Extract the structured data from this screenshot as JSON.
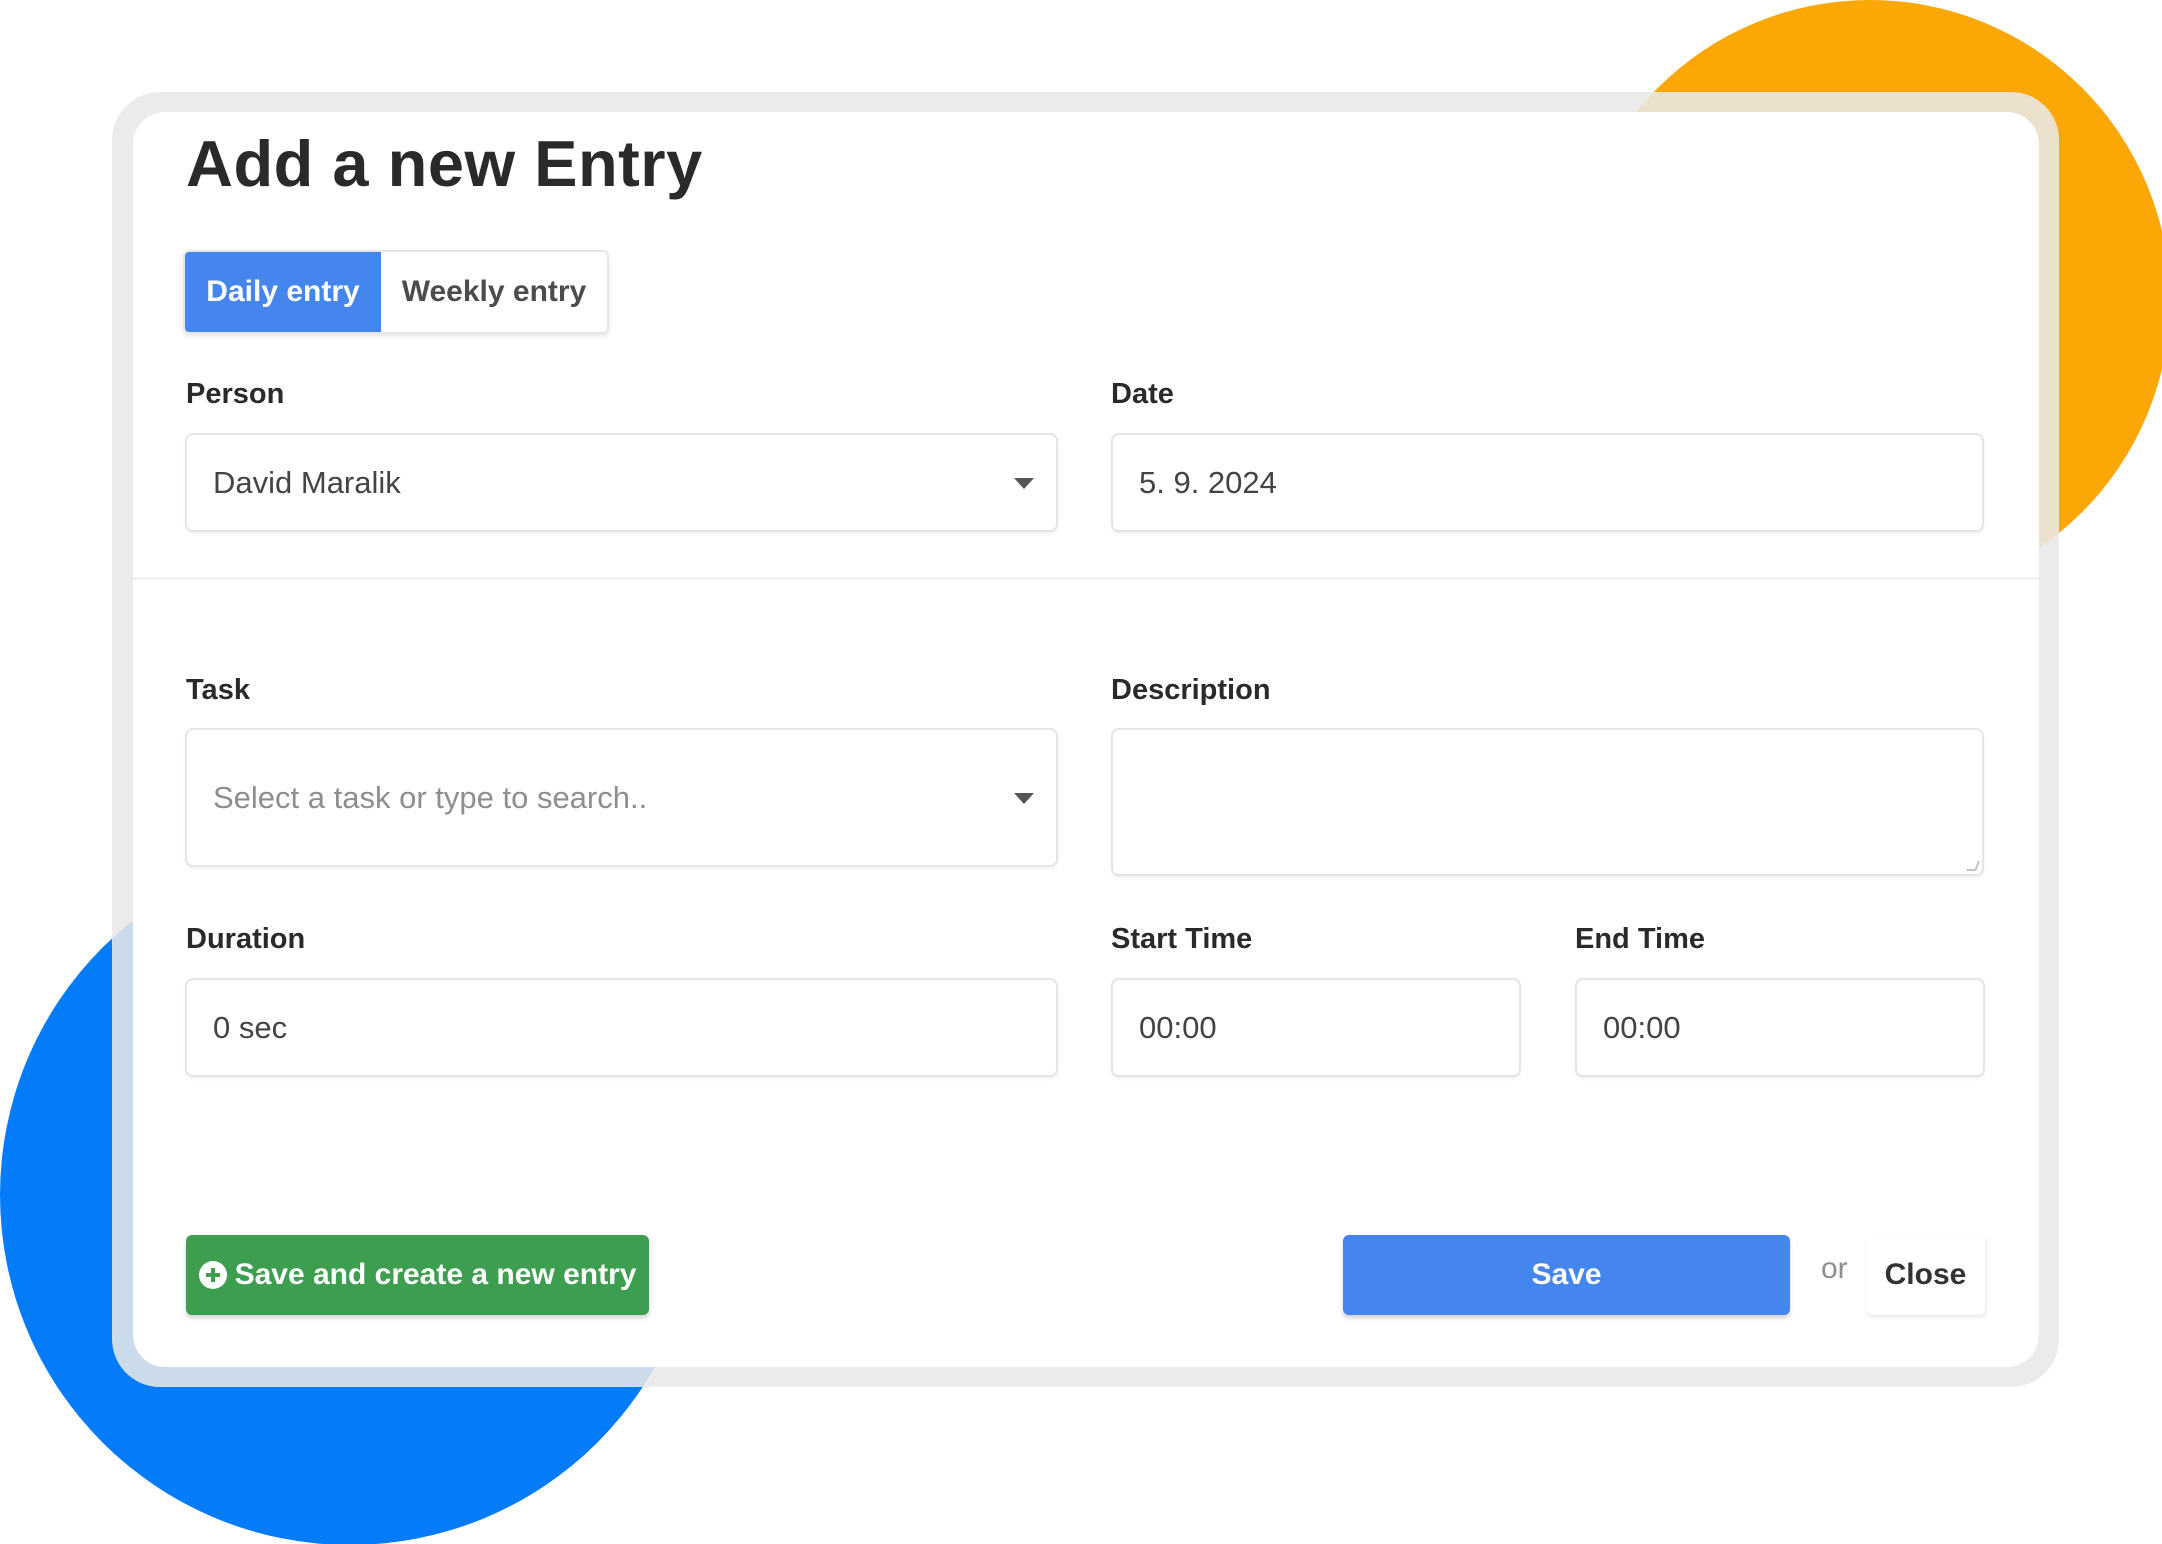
{
  "dialog": {
    "title": "Add a new Entry"
  },
  "entry_mode": {
    "options": [
      "Daily entry",
      "Weekly entry"
    ],
    "selected": "Daily entry"
  },
  "form": {
    "person": {
      "label": "Person",
      "value": "David Maralik"
    },
    "date": {
      "label": "Date",
      "value": "5. 9. 2024"
    },
    "task": {
      "label": "Task",
      "placeholder": "Select a task or type to search..",
      "value": ""
    },
    "description": {
      "label": "Description",
      "value": ""
    },
    "duration": {
      "label": "Duration",
      "value": "0 sec"
    },
    "start_time": {
      "label": "Start Time",
      "value": "00:00"
    },
    "end_time": {
      "label": "End Time",
      "value": "00:00"
    }
  },
  "actions": {
    "save_new": "Save and create a new entry",
    "save": "Save",
    "or": "or",
    "close": "Close"
  },
  "colors": {
    "primary": "#4486EE",
    "success": "#3E9E4F",
    "accent_orange": "#FBA806",
    "accent_blue": "#047CF9"
  }
}
